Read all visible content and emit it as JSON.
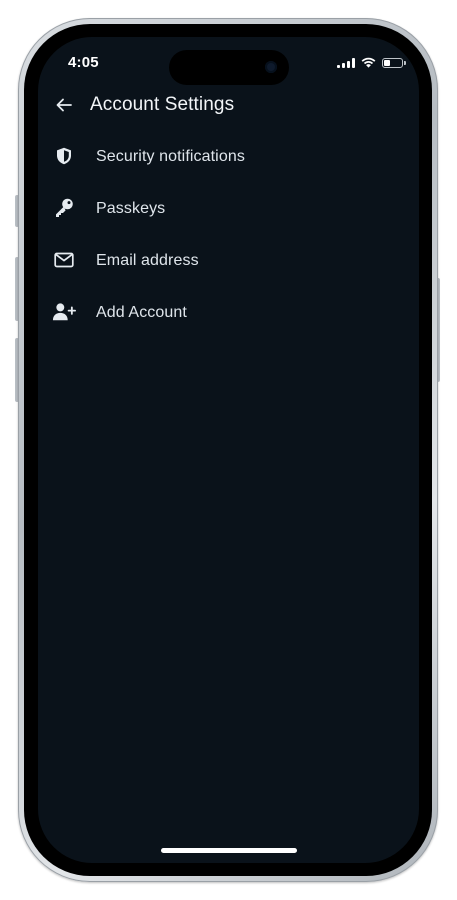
{
  "status_bar": {
    "time": "4:05",
    "battery_level": 0.35,
    "icons": [
      "signal-icon",
      "wifi-icon",
      "battery-icon"
    ]
  },
  "header": {
    "back_icon": "arrow-left-icon",
    "title": "Account Settings"
  },
  "settings": {
    "items": [
      {
        "icon": "shield-icon",
        "label": "Security notifications"
      },
      {
        "icon": "key-icon",
        "label": "Passkeys"
      },
      {
        "icon": "mail-icon",
        "label": "Email address"
      },
      {
        "icon": "add-user-icon",
        "label": "Add Account"
      }
    ]
  },
  "colors": {
    "background": "#0a121a",
    "text_primary": "#f2f5f8",
    "text_secondary": "#dfe5eb",
    "icon": "#e6ebf0"
  }
}
